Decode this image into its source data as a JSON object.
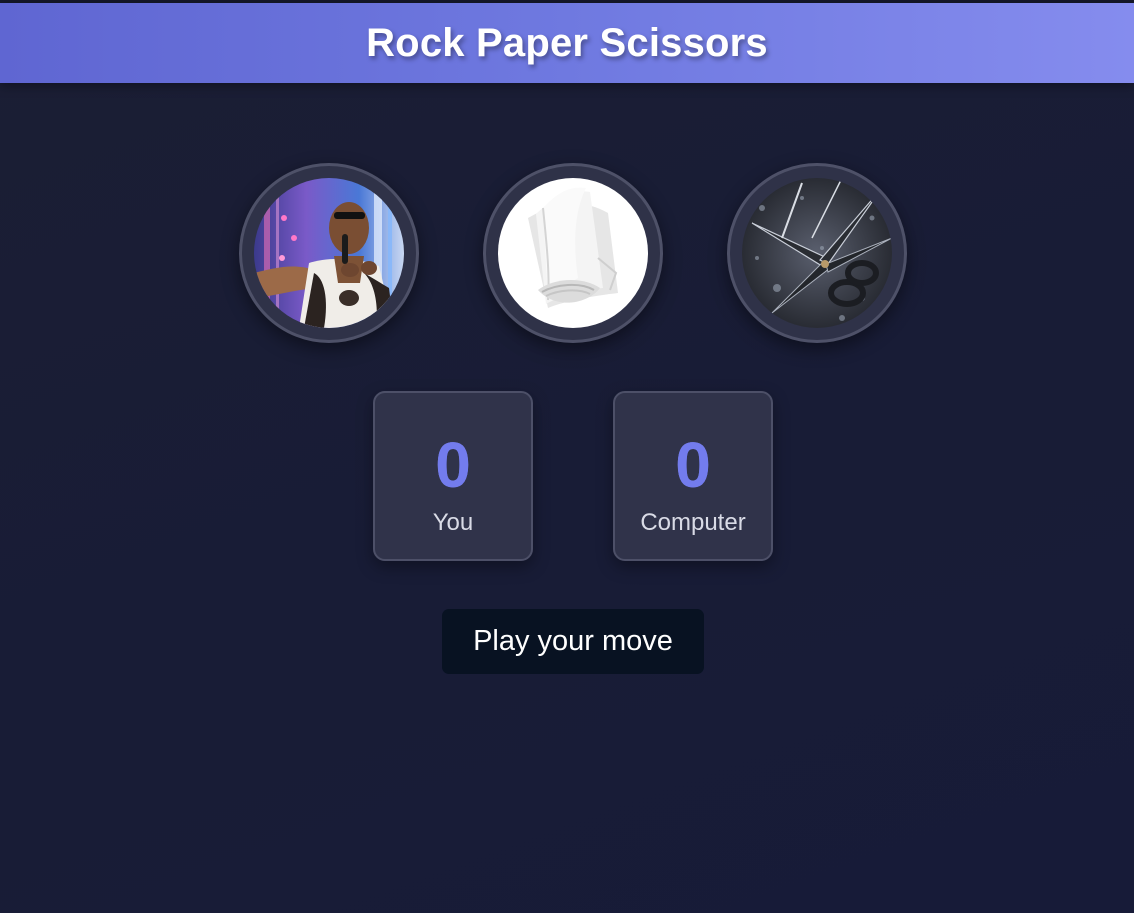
{
  "header": {
    "title": "Rock Paper Scissors"
  },
  "choices": [
    {
      "id": "rock",
      "image": "wrestler-photo"
    },
    {
      "id": "paper",
      "image": "paper-stack-photo"
    },
    {
      "id": "scissors",
      "image": "scissors-photo"
    }
  ],
  "scores": {
    "user": {
      "value": "0",
      "label": "You"
    },
    "computer": {
      "value": "0",
      "label": "Computer"
    }
  },
  "message": {
    "text": "Play your move"
  },
  "colors": {
    "header_start": "#5f66d2",
    "header_end": "#858cee",
    "score_accent": "#737ced",
    "message_bg": "#081222",
    "page_bg": "#1a1d35"
  }
}
